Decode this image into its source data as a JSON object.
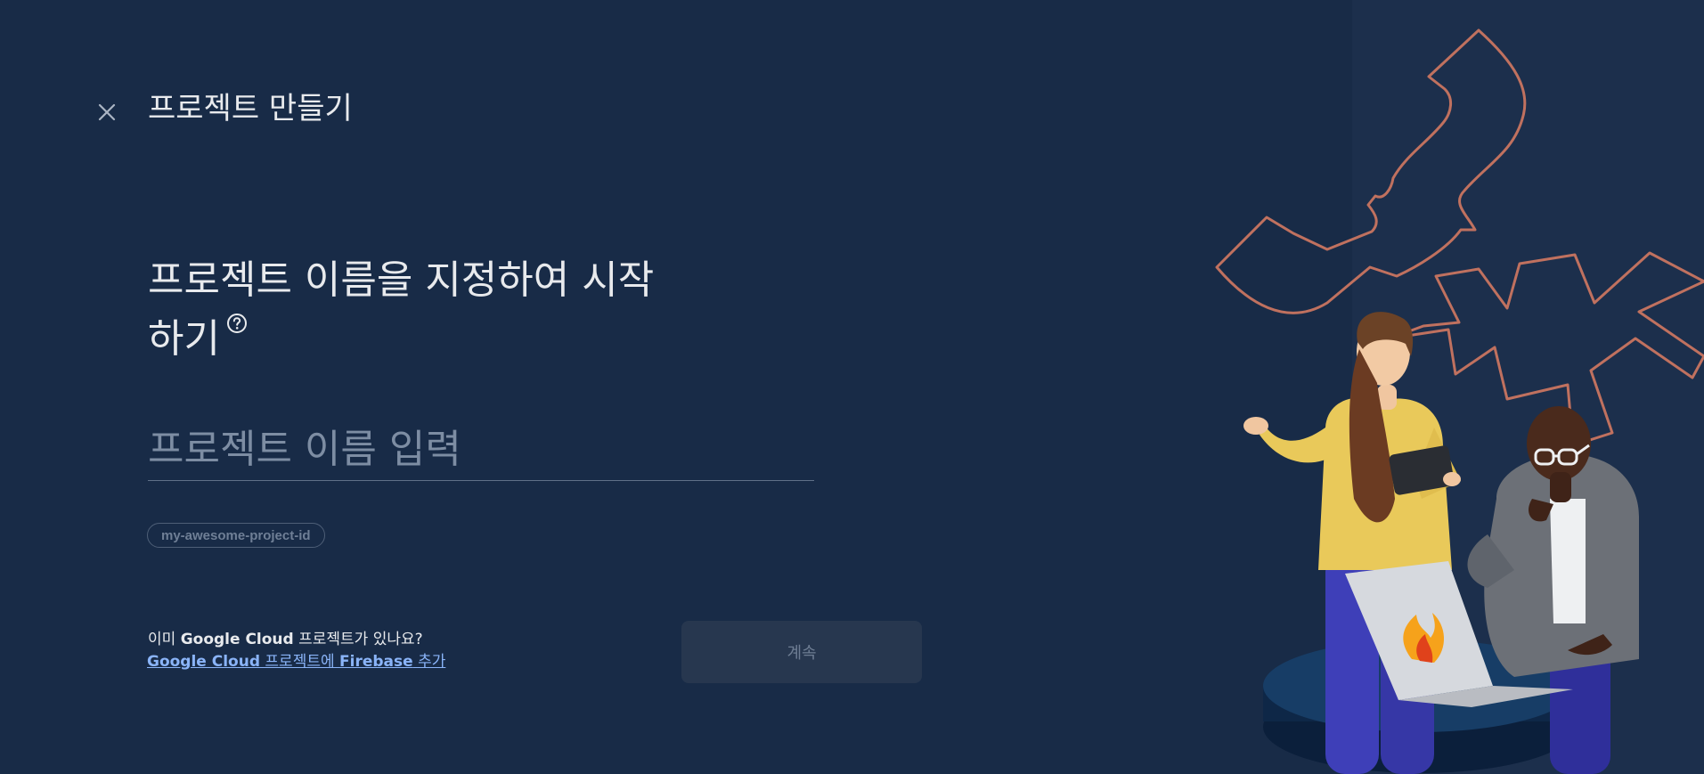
{
  "header": {
    "close_label": "×",
    "title": "프로젝트 만들기"
  },
  "main": {
    "heading_line1": "프로젝트 이름을 지정하여 시작",
    "heading_line2": "하기",
    "name_input": {
      "value": "",
      "placeholder": "프로젝트 이름 입력"
    },
    "project_id": "my-awesome-project-id",
    "gc_question_prefix": "이미 ",
    "gc_question_brand": "Google Cloud",
    "gc_question_suffix": " 프로젝트가 있나요?",
    "gc_link_part1": "Google Cloud",
    "gc_link_part2": " 프로젝트에 ",
    "gc_link_part3": "Firebase",
    "gc_link_part4": " 추가",
    "continue_label": "계속"
  },
  "colors": {
    "background": "#182b47",
    "accent_link": "#8ab4f8",
    "illustration_line": "#c0715f"
  },
  "icons": {
    "close": "close-icon",
    "help": "help-circle-icon",
    "firebase_logo": "firebase-flame-icon"
  }
}
